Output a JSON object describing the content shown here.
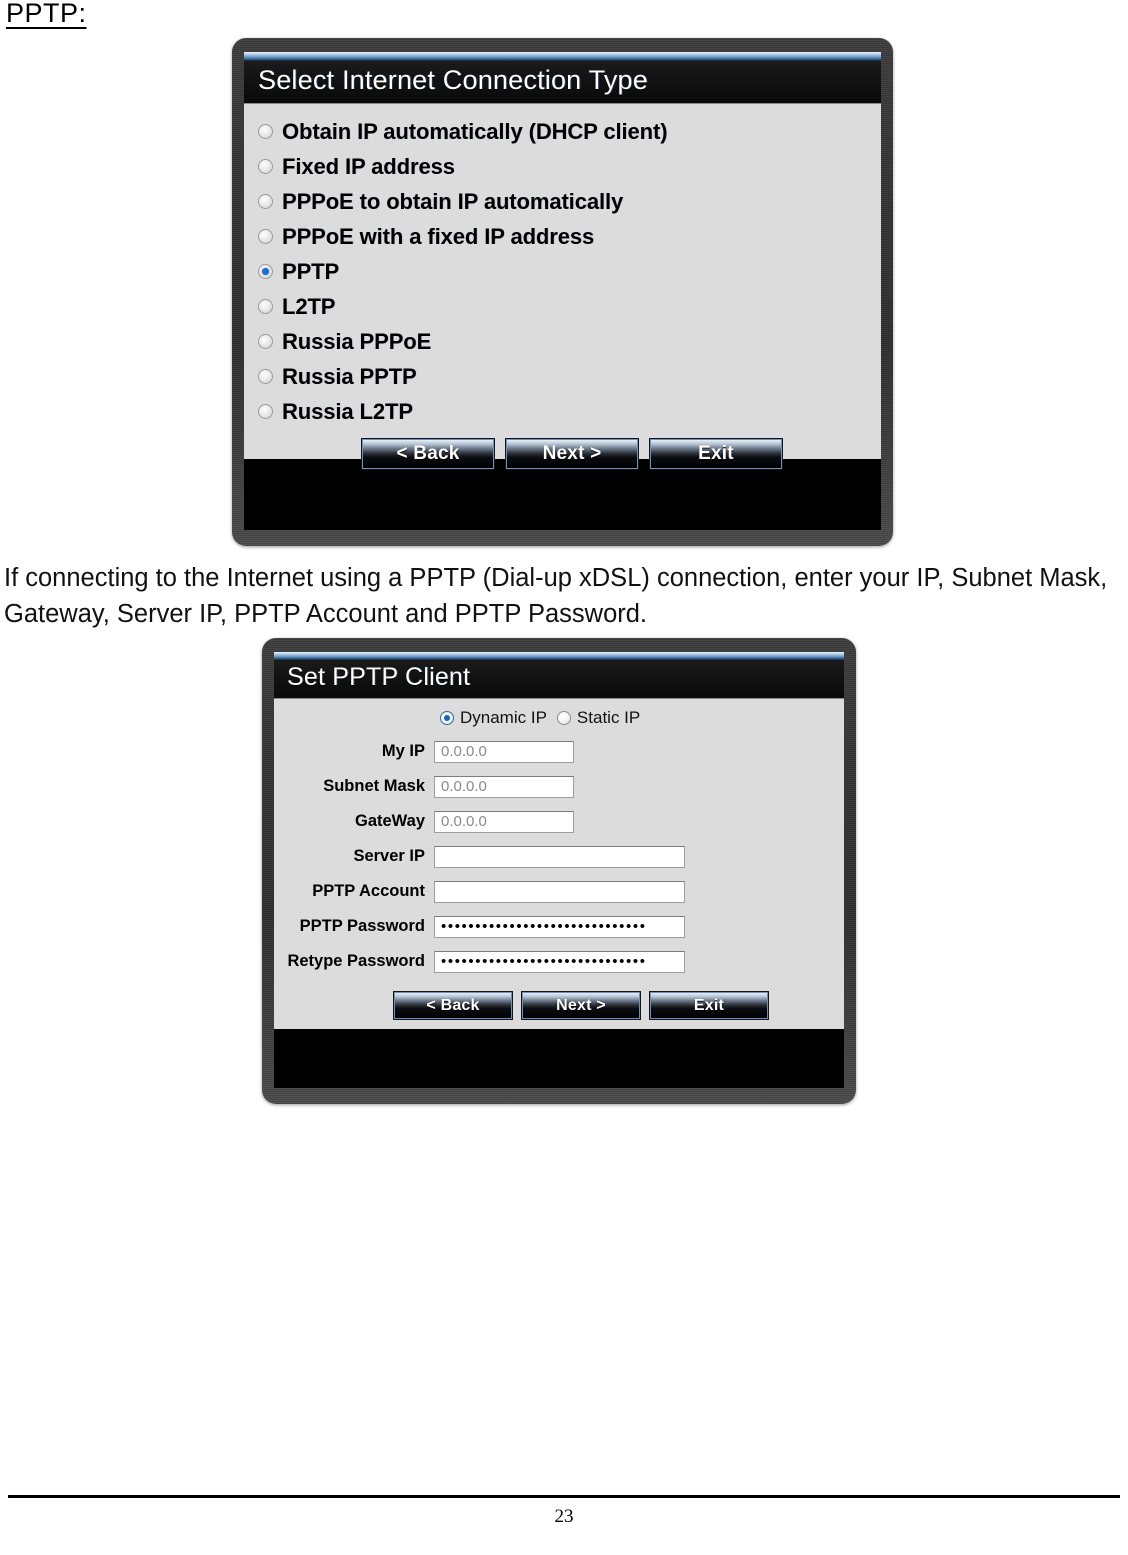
{
  "page": {
    "heading": "PPTP:",
    "paragraph": "If connecting to the Internet using a PPTP (Dial-up xDSL) connection, enter your IP, Subnet Mask, Gateway, Server IP, PPTP Account and PPTP Password.",
    "page_number": "23"
  },
  "dialog_connection_type": {
    "title": "Select Internet Connection Type",
    "options": [
      {
        "label": "Obtain IP automatically (DHCP client)",
        "selected": false
      },
      {
        "label": "Fixed IP address",
        "selected": false
      },
      {
        "label": "PPPoE to obtain IP automatically",
        "selected": false
      },
      {
        "label": "PPPoE with a fixed IP address",
        "selected": false
      },
      {
        "label": "PPTP",
        "selected": true
      },
      {
        "label": "L2TP",
        "selected": false
      },
      {
        "label": "Russia PPPoE",
        "selected": false
      },
      {
        "label": "Russia PPTP",
        "selected": false
      },
      {
        "label": "Russia L2TP",
        "selected": false
      }
    ],
    "buttons": {
      "back": "< Back",
      "next": "Next >",
      "exit": "Exit"
    }
  },
  "dialog_set_pptp_client": {
    "title": "Set PPTP Client",
    "ip_mode": {
      "dynamic_label": "Dynamic IP",
      "static_label": "Static IP",
      "selected": "Dynamic IP"
    },
    "fields": [
      {
        "label": "My IP",
        "value": "0.0.0.0",
        "width": "short",
        "type": "text"
      },
      {
        "label": "Subnet Mask",
        "value": "0.0.0.0",
        "width": "short",
        "type": "text"
      },
      {
        "label": "GateWay",
        "value": "0.0.0.0",
        "width": "short",
        "type": "text"
      },
      {
        "label": "Server IP",
        "value": "",
        "width": "long",
        "type": "text"
      },
      {
        "label": "PPTP Account",
        "value": "",
        "width": "long",
        "type": "text"
      },
      {
        "label": "PPTP Password",
        "value": "••••••••••••••••••••••••••••••",
        "width": "long",
        "type": "password"
      },
      {
        "label": "Retype Password",
        "value": "••••••••••••••••••••••••••••••",
        "width": "long",
        "type": "password"
      }
    ],
    "buttons": {
      "back": "< Back",
      "next": "Next >",
      "exit": "Exit"
    }
  },
  "colors": {
    "accent_blue": "#1a6fd4",
    "bezel_dark": "#343434",
    "panel_grey": "#dcdcdc",
    "title_bar": "#0f0f0f"
  }
}
